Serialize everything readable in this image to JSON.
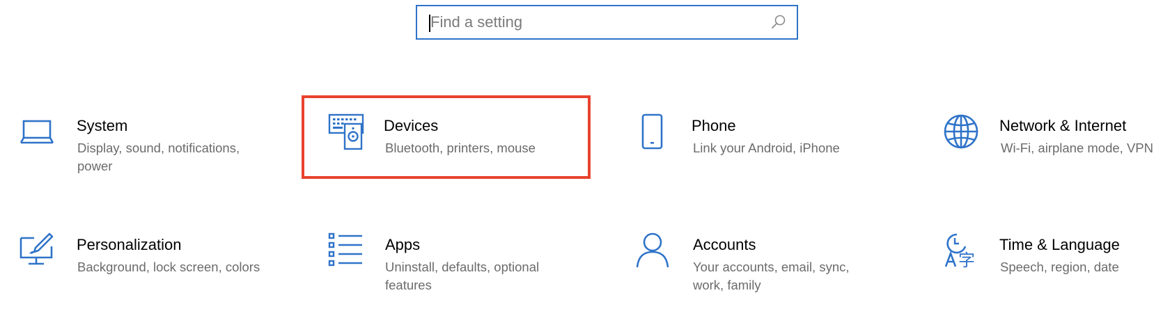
{
  "search": {
    "placeholder": "Find a setting"
  },
  "categories": [
    {
      "title": "System",
      "desc": "Display, sound, notifications, power",
      "icon": "laptop-icon"
    },
    {
      "title": "Devices",
      "desc": "Bluetooth, printers, mouse",
      "icon": "devices-icon"
    },
    {
      "title": "Phone",
      "desc": "Link your Android, iPhone",
      "icon": "phone-icon"
    },
    {
      "title": "Network & Internet",
      "desc": "Wi-Fi, airplane mode, VPN",
      "icon": "globe-icon"
    },
    {
      "title": "Personalization",
      "desc": "Background, lock screen, colors",
      "icon": "personalization-icon"
    },
    {
      "title": "Apps",
      "desc": "Uninstall, defaults, optional features",
      "icon": "apps-list-icon"
    },
    {
      "title": "Accounts",
      "desc": "Your accounts, email, sync, work, family",
      "icon": "person-icon"
    },
    {
      "title": "Time & Language",
      "desc": "Speech, region, date",
      "icon": "time-language-icon"
    }
  ],
  "colors": {
    "accent": "#2f73c9",
    "highlight": "#e8432f",
    "desc_text": "#6b6b6b"
  }
}
